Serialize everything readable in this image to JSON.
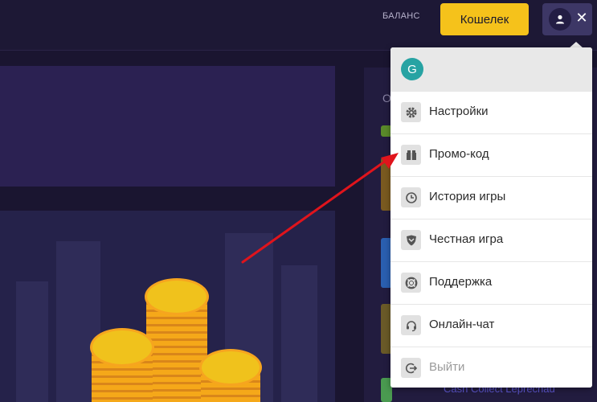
{
  "header": {
    "balance_label": "БАЛАНС",
    "wallet_button": "Кошелек",
    "close_symbol": "✕"
  },
  "right_panel": {
    "partial_label": "О",
    "bottom_game_text": "Cash Collect Leprechau"
  },
  "profile_menu": {
    "avatar_letter": "G",
    "items": [
      {
        "label": "Настройки",
        "icon": "gear-icon"
      },
      {
        "label": "Промо-код",
        "icon": "gift-icon"
      },
      {
        "label": "История игры",
        "icon": "clock-icon"
      },
      {
        "label": "Честная игра",
        "icon": "shield-icon"
      },
      {
        "label": "Поддержка",
        "icon": "lifebuoy-icon"
      },
      {
        "label": "Онлайн-чат",
        "icon": "headset-icon"
      },
      {
        "label": "Выйти",
        "icon": "logout-icon"
      }
    ]
  },
  "colors": {
    "wallet_button": "#f5c21b",
    "background": "#1a1530",
    "avatar": "#27a3a3",
    "arrow": "#e0141c"
  }
}
